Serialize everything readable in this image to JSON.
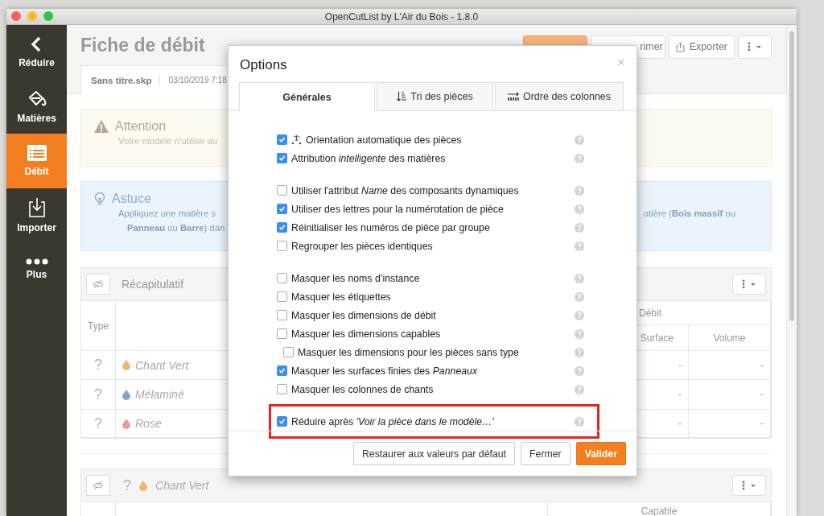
{
  "window": {
    "title": "OpenCutList by L'Air du Bois - 1.8.0"
  },
  "sidebar": {
    "items": [
      {
        "label": "Réduire",
        "kind": "back",
        "selected": false
      },
      {
        "label": "Matières",
        "kind": "materials",
        "selected": false
      },
      {
        "label": "Débit",
        "kind": "cutlist",
        "selected": true
      },
      {
        "label": "Importer",
        "kind": "import",
        "selected": false
      },
      {
        "label": "Plus",
        "kind": "more",
        "selected": false
      }
    ]
  },
  "page": {
    "title": "Fiche de débit",
    "toolbar": [
      {
        "kind": "primary"
      },
      {
        "label": "rimer",
        "kind": "print"
      },
      {
        "label": "Exporter",
        "kind": "export"
      },
      {
        "kind": "menu"
      }
    ],
    "file_tab": {
      "name": "Sans titre.skp",
      "date": "03/10/2019 7:18"
    },
    "alerts": [
      {
        "kind": "warning",
        "title": "Attention",
        "lines": [
          "Votre modèle n’utilise au"
        ]
      },
      {
        "kind": "tip",
        "title": "Astuce",
        "lines": [
          "Appliquez une matière s",
          "**Panneau** ou **Barre**) dan"
        ],
        "right_lines": [
          "atière (**Bois massif** ou"
        ]
      }
    ],
    "summary": {
      "title": "Récapitulatif",
      "columns": {
        "type": "Type",
        "group": "Débit",
        "surface": "Surface",
        "volume": "Volume"
      },
      "rows": [
        {
          "type": "?",
          "name": "Chant Vert",
          "color": "#f2b46a",
          "surface": "-",
          "volume": "-"
        },
        {
          "type": "?",
          "name": "Mélaminé",
          "color": "#7fa4c9",
          "surface": "-",
          "volume": "-"
        },
        {
          "type": "?",
          "name": "Rose",
          "color": "#e99a9c",
          "surface": "-",
          "volume": "-"
        }
      ]
    },
    "group_panel": {
      "type": "?",
      "name": "Chant Vert",
      "color": "#f2b46a",
      "columns": [
        "Capable"
      ]
    }
  },
  "dialog": {
    "title": "Options",
    "close": "×",
    "tabs": [
      {
        "label": "Générales",
        "kind": "plain",
        "selected": true
      },
      {
        "label": "Tri des pièces",
        "kind": "sort",
        "selected": false
      },
      {
        "label": "Ordre des colonnes",
        "kind": "columns",
        "selected": false
      }
    ],
    "groups": [
      [
        {
          "label": "Orientation automatique des pièces",
          "kind": "with-icon",
          "checked": true,
          "indented": false,
          "highlighted": false
        },
        {
          "label": "Attribution *intelligente* des matières",
          "kind": "plain",
          "checked": true,
          "indented": false,
          "highlighted": false
        }
      ],
      [
        {
          "label": "Utiliser l'attribut *Name* des composants dynamiques",
          "kind": "plain",
          "checked": false,
          "indented": false,
          "highlighted": false
        },
        {
          "label": "Utiliser des lettres pour la numérotation de pièce",
          "kind": "plain",
          "checked": true,
          "indented": false,
          "highlighted": false
        },
        {
          "label": "Réinitialiser les numéros de pièce par groupe",
          "kind": "plain",
          "checked": true,
          "indented": false,
          "highlighted": false
        },
        {
          "label": "Regrouper les pièces identiques",
          "kind": "plain",
          "checked": false,
          "indented": false,
          "highlighted": false
        }
      ],
      [
        {
          "label": "Masquer les noms d’instance",
          "kind": "plain",
          "checked": false,
          "indented": false,
          "highlighted": false
        },
        {
          "label": "Masquer les étiquettes",
          "kind": "plain",
          "checked": false,
          "indented": false,
          "highlighted": false
        },
        {
          "label": "Masquer les dimensions de débit",
          "kind": "plain",
          "checked": false,
          "indented": false,
          "highlighted": false
        },
        {
          "label": "Masquer les dimensions capables",
          "kind": "plain",
          "checked": false,
          "indented": false,
          "highlighted": false
        },
        {
          "label": "Masquer les dimensions pour les pièces sans type",
          "kind": "plain",
          "checked": false,
          "indented": true,
          "highlighted": false
        },
        {
          "label": "Masquer les surfaces finies des *Panneaux*",
          "kind": "plain",
          "checked": true,
          "indented": false,
          "highlighted": false
        },
        {
          "label": "Masquer les colonnes de chants",
          "kind": "plain",
          "checked": false,
          "indented": false,
          "highlighted": false
        }
      ],
      [
        {
          "label": "Réduire après *'Voir la pièce dans le modèle…'*",
          "kind": "plain",
          "checked": true,
          "indented": false,
          "highlighted": true
        }
      ]
    ],
    "buttons": [
      {
        "label": "Restaurer aux valeurs par défaut",
        "kind": "default"
      },
      {
        "label": "Fermer",
        "kind": "default"
      },
      {
        "label": "Valider",
        "kind": "primary"
      }
    ]
  }
}
